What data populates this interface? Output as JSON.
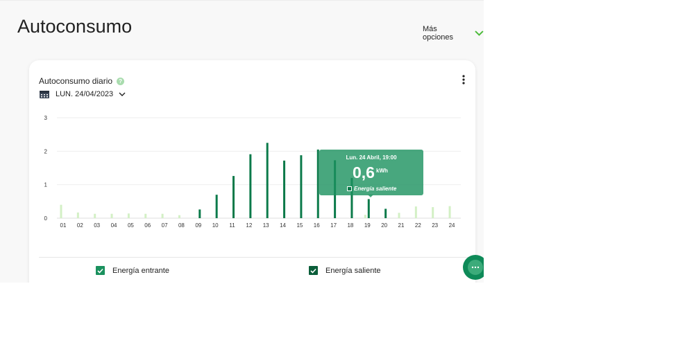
{
  "page": {
    "title": "Autoconsumo",
    "more_options": "Más opciones"
  },
  "card": {
    "title": "Autoconsumo diario",
    "date": "LUN. 24/04/2023"
  },
  "tooltip": {
    "date": "Lun. 24 Abril, 19:00",
    "value": "0,6",
    "unit": "kWh",
    "series": "Energía saliente"
  },
  "colors": {
    "incoming": "#d3f0c5",
    "outgoing": "#0b7a4a",
    "accent": "#1a915e",
    "tooltip_bg": "#4aaf86"
  },
  "icons": {
    "help": "question-circle-icon",
    "calendar": "calendar-icon",
    "chevron": "chevron-down-icon",
    "menu": "kebab-menu-icon",
    "chat": "chat-bubble-icon"
  },
  "chart_data": {
    "type": "bar",
    "categories": [
      "01",
      "02",
      "03",
      "04",
      "05",
      "06",
      "07",
      "08",
      "09",
      "10",
      "11",
      "12",
      "13",
      "14",
      "15",
      "16",
      "17",
      "18",
      "19",
      "20",
      "21",
      "22",
      "23",
      "24"
    ],
    "ylim": [
      0,
      3
    ],
    "yticks": [
      "0",
      "1",
      "2",
      "3"
    ],
    "grid": true,
    "legend": "bottom",
    "series": [
      {
        "name": "Energía entrante",
        "values": [
          0.4,
          0.17,
          0.13,
          0.13,
          0.14,
          0.13,
          0.13,
          0.09,
          0,
          0,
          0,
          0,
          0,
          0,
          0,
          0,
          0,
          0,
          0.1,
          0,
          0.16,
          0.35,
          0.33,
          0.36
        ]
      },
      {
        "name": "Energía saliente",
        "values": [
          0,
          0,
          0,
          0,
          0,
          0,
          0,
          0,
          0.26,
          0.7,
          1.26,
          1.91,
          2.25,
          1.72,
          1.88,
          2.05,
          1.73,
          1.2,
          0.57,
          0.28,
          0,
          0,
          0,
          0
        ]
      }
    ]
  }
}
